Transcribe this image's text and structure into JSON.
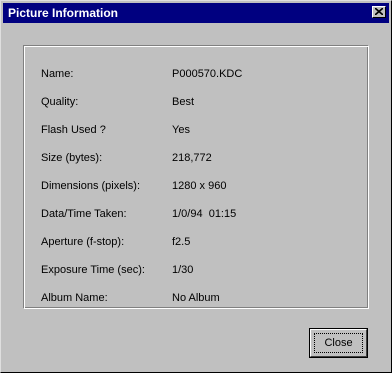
{
  "window": {
    "title": "Picture Information",
    "close_icon": "close-x-icon"
  },
  "info": {
    "rows": [
      {
        "label": "Name:",
        "value": "P000570.KDC"
      },
      {
        "label": "Quality:",
        "value": "Best"
      },
      {
        "label": "Flash Used ?",
        "value": "Yes"
      },
      {
        "label": "Size (bytes):",
        "value": "218,772"
      },
      {
        "label": "Dimensions (pixels):",
        "value": "1280 x 960"
      },
      {
        "label": "Data/Time Taken:",
        "value": "1/0/94  01:15"
      },
      {
        "label": "Aperture (f-stop):",
        "value": "f2.5"
      },
      {
        "label": "Exposure Time (sec):",
        "value": "1/30"
      },
      {
        "label": "Album Name:",
        "value": "No Album"
      }
    ]
  },
  "buttons": {
    "close_label": "Close"
  },
  "colors": {
    "titlebar": "#000080",
    "face": "#c0c0c0"
  }
}
